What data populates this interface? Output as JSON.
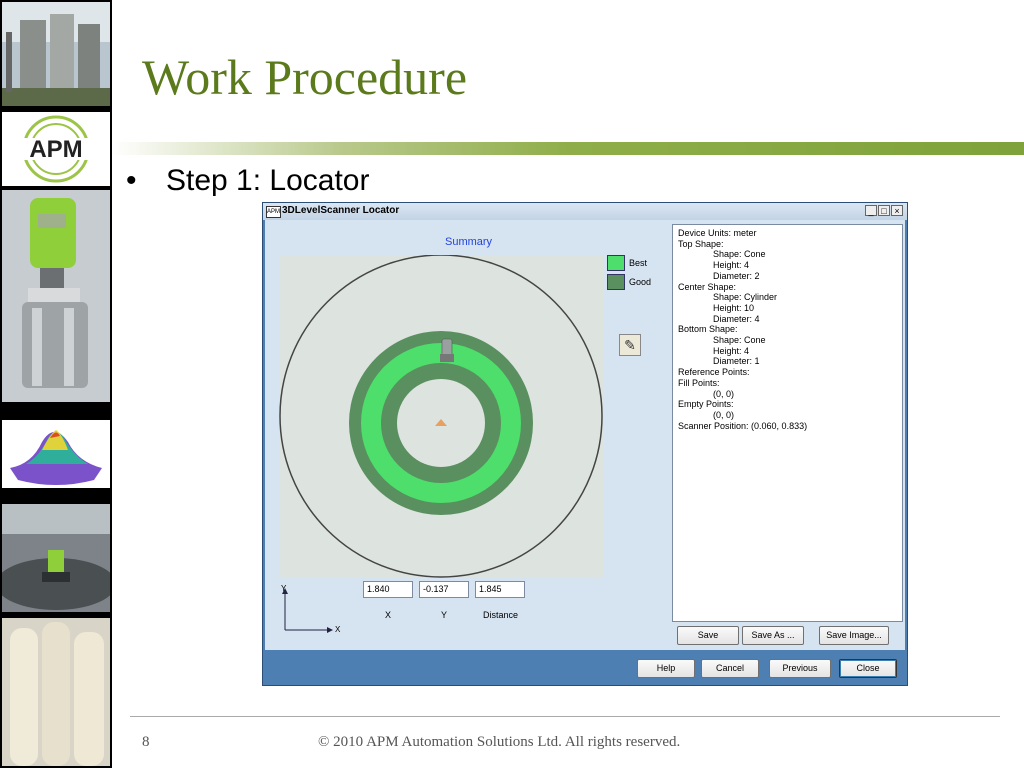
{
  "slide": {
    "title": "Work Procedure",
    "bullet": "•",
    "step_text": "Step 1: Locator",
    "page_number": "8",
    "copyright": "© 2010 APM Automation Solutions Ltd. All rights reserved.",
    "logo_text": "APM"
  },
  "window": {
    "title": "3DLevelScanner Locator",
    "logo_text": "APM",
    "buttons": {
      "minimize": "_",
      "maximize": "□",
      "close": "×"
    }
  },
  "summary": {
    "title": "Summary",
    "legend": [
      {
        "label": "Best",
        "color": "#4dde6b"
      },
      {
        "label": "Good",
        "color": "#5a8f5f"
      }
    ],
    "colors": {
      "best": "#4dde6b",
      "good": "#5a8f5f",
      "plot_bg": "#dde3de",
      "circle": "#444444",
      "marker": "#e8a060"
    }
  },
  "coords": {
    "x_value": "1.840",
    "y_value": "-0.137",
    "distance_value": "1.845",
    "x_label": "X",
    "y_label": "Y",
    "distance_label": "Distance",
    "axis_y": "Y",
    "axis_x": "X"
  },
  "info": {
    "lines": [
      {
        "text": "Device Units: meter",
        "indent": 0
      },
      {
        "text": "Top Shape:",
        "indent": 0
      },
      {
        "text": "Shape: Cone",
        "indent": 1
      },
      {
        "text": "Height: 4",
        "indent": 1
      },
      {
        "text": "Diameter: 2",
        "indent": 1
      },
      {
        "text": "Center Shape:",
        "indent": 0
      },
      {
        "text": "Shape: Cylinder",
        "indent": 1
      },
      {
        "text": "Height: 10",
        "indent": 1
      },
      {
        "text": "Diameter: 4",
        "indent": 1
      },
      {
        "text": "Bottom Shape:",
        "indent": 0
      },
      {
        "text": "Shape: Cone",
        "indent": 1
      },
      {
        "text": "Height: 4",
        "indent": 1
      },
      {
        "text": "Diameter: 1",
        "indent": 1
      },
      {
        "text": "Reference Points:",
        "indent": 0
      },
      {
        "text": "Fill Points:",
        "indent": 0
      },
      {
        "text": "(0, 0)",
        "indent": 1
      },
      {
        "text": "Empty Points:",
        "indent": 0
      },
      {
        "text": "(0, 0)",
        "indent": 1
      },
      {
        "text": "Scanner Position: (0.060, 0.833)",
        "indent": 0
      }
    ]
  },
  "panel_buttons": {
    "save": "Save",
    "save_as": "Save As ...",
    "save_image": "Save Image..."
  },
  "nav_buttons": {
    "help": "Help",
    "cancel": "Cancel",
    "previous": "Previous",
    "close": "Close"
  }
}
